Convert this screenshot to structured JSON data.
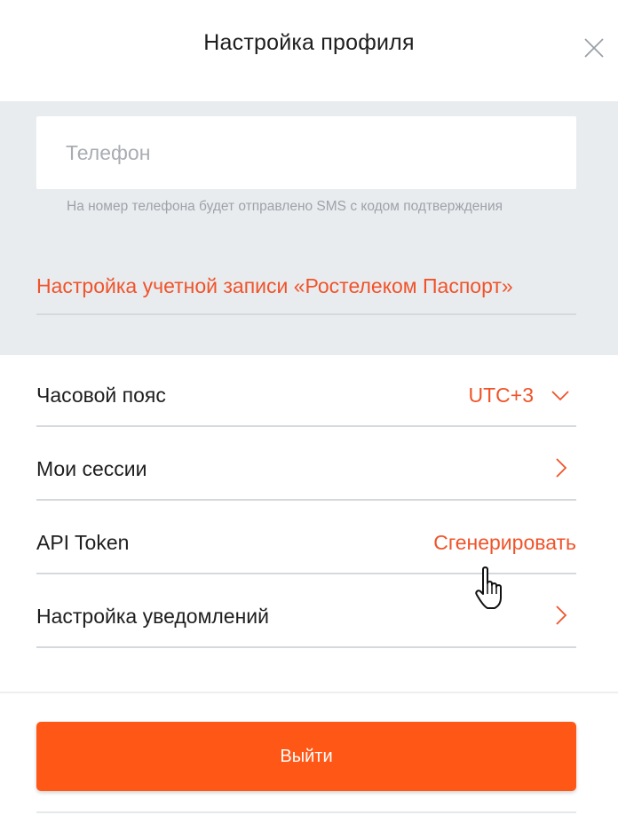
{
  "header": {
    "title": "Настройка профиля",
    "close_icon": "close-icon"
  },
  "phone": {
    "placeholder": "Телефон",
    "value": "",
    "hint": "На номер телефона будет отправлено SMS с кодом подтверждения"
  },
  "account": {
    "passport_link": "Настройка учетной записи «Ростелеком Паспорт»"
  },
  "settings": {
    "timezone_label": "Часовой пояс",
    "timezone_value": "UTC+3",
    "sessions_label": "Мои сессии",
    "api_token_label": "API Token",
    "api_token_action": "Сгенерировать",
    "notifications_label": "Настройка уведомлений"
  },
  "footer": {
    "logout_label": "Выйти"
  },
  "colors": {
    "accent": "#f0532a",
    "button": "#ff5716",
    "section_bg": "#e9ecef"
  },
  "icons": {
    "chevron_down": "chevron-down-icon",
    "chevron_right": "chevron-right-icon",
    "cursor": "hand-pointer-icon"
  }
}
